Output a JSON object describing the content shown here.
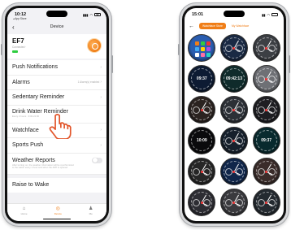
{
  "left_phone": {
    "status": {
      "time": "10:12",
      "sub": "◂ App Store",
      "signal": "▮▮▮",
      "wifi": "◠",
      "battery": "52"
    },
    "nav": {
      "back": "‹",
      "title": "Device"
    },
    "device": {
      "name": "EF7",
      "sub": "Connected ·"
    },
    "menu": [
      {
        "label": "Push Notifications",
        "right": ""
      },
      {
        "label": "Alarms",
        "right": "1 Alarm(s) enabled"
      },
      {
        "label": "Sedentary Reminder",
        "right": ""
      },
      {
        "label": "Drink Water Reminder",
        "right": "",
        "desc": "Every 2 hours · 9:00-21:00"
      },
      {
        "label": "Watchface",
        "right": ""
      },
      {
        "label": "Sports Push",
        "right": ""
      },
      {
        "label": "Weather Reports",
        "right": "",
        "desc": "After turning on, the weather information will be synchronized to the watch every 1 hour and when the APP is opened"
      },
      {
        "label": "Raise to Wake",
        "right": ""
      }
    ],
    "tabs": [
      {
        "label": "Home",
        "icon": "⌂"
      },
      {
        "label": "Device",
        "icon": "◎"
      },
      {
        "label": "Me",
        "icon": "♟"
      }
    ]
  },
  "right_phone": {
    "status": {
      "time": "15:01",
      "signal": "▮▮",
      "wifi": "◠",
      "battery": ""
    },
    "back": "←",
    "segments": [
      {
        "label": "Watchface Store",
        "active": true
      },
      {
        "label": "My Watchface",
        "active": false
      }
    ],
    "faces": [
      {
        "name": "watchface-apps",
        "time": "",
        "bg": "#2a5db0",
        "kind": "apps"
      },
      {
        "name": "watchface-chrono-blue",
        "time": "",
        "bg": "#1a2a44",
        "kind": "analog"
      },
      {
        "name": "watchface-skeleton",
        "time": "",
        "bg": "#3c3f44",
        "kind": "analog"
      },
      {
        "name": "watchface-digital-blue",
        "time": "09:37",
        "bg": "#0d1b33",
        "kind": "digital"
      },
      {
        "name": "watchface-digital-teal",
        "time": "09:42:13",
        "bg": "#0f2b2b",
        "kind": "digital"
      },
      {
        "name": "watchface-silver",
        "time": "",
        "bg": "#6e7075",
        "kind": "analog"
      },
      {
        "name": "watchface-chrono-orange",
        "time": "",
        "bg": "#2b2320",
        "kind": "analog"
      },
      {
        "name": "watchface-steel",
        "time": "",
        "bg": "#2c3036",
        "kind": "analog"
      },
      {
        "name": "watchface-classic",
        "time": "",
        "bg": "#1e1e22",
        "kind": "analog"
      },
      {
        "name": "watchface-digital-black",
        "time": "10:09",
        "bg": "#0a0a0c",
        "kind": "digital"
      },
      {
        "name": "watchface-gauge",
        "time": "",
        "bg": "#16202c",
        "kind": "analog"
      },
      {
        "name": "watchface-teal-digital",
        "time": "09:37",
        "bg": "#082a2e",
        "kind": "digital"
      },
      {
        "name": "watchface-sport",
        "time": "",
        "bg": "#262626",
        "kind": "analog"
      },
      {
        "name": "watchface-blue-dial",
        "time": "",
        "bg": "#10264a",
        "kind": "analog"
      },
      {
        "name": "watchface-rose",
        "time": "",
        "bg": "#3a2c2a",
        "kind": "analog"
      },
      {
        "name": "watchface-partial-1",
        "time": "",
        "bg": "#2d2d33",
        "kind": "analog"
      },
      {
        "name": "watchface-partial-2",
        "time": "",
        "bg": "#3a3a3e",
        "kind": "analog"
      },
      {
        "name": "watchface-partial-3",
        "time": "",
        "bg": "#242a30",
        "kind": "analog"
      }
    ]
  },
  "colors": {
    "accent": "#f07e17",
    "toggle_off": "#e6e6e9"
  }
}
